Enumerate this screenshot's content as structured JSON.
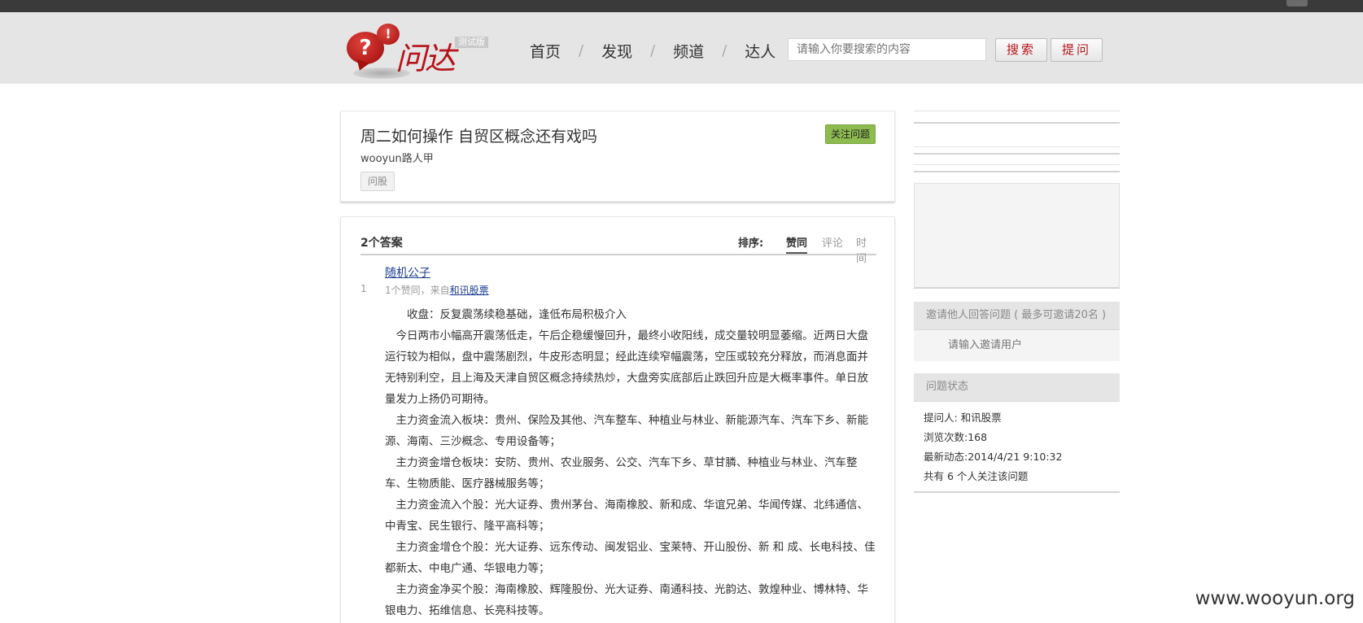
{
  "header": {
    "logo_glyph": "?",
    "logo_small_glyph": "!",
    "logo_text": "问达",
    "beta_badge": "测试版",
    "nav": [
      {
        "label": "首页"
      },
      {
        "label": "发现"
      },
      {
        "label": "频道"
      },
      {
        "label": "达人"
      }
    ],
    "nav_separator": "/",
    "search_placeholder": "请输入你要搜索的内容",
    "search_button": "搜索",
    "ask_button": "提问"
  },
  "question": {
    "title": "周二如何操作 自贸区概念还有戏吗",
    "author": "wooyun路人甲",
    "tag": "问股",
    "follow_button": "关注问题"
  },
  "answers": {
    "count_label": "2个答案",
    "sort_label": "排序:",
    "sort_options": [
      "赞同",
      "评论",
      "时间"
    ],
    "active_sort": "赞同",
    "items": [
      {
        "votes": "1",
        "author": "随机公子",
        "meta_prefix": "1个赞同，来自",
        "source": "和讯股票",
        "paragraphs": [
          "收盘：反复震荡续稳基础，逢低布局积极介入",
          "今日两市小幅高开震荡低走，午后企稳缓慢回升，最终小收阳线，成交量较明显萎缩。近两日大盘运行较为相似，盘中震荡剧烈，牛皮形态明显；经此连续窄幅震荡，空压或较充分释放，而消息面并无特别利空，且上海及天津自贸区概念持续热炒，大盘旁实底部后止跌回升应是大概率事件。单日放量发力上扬仍可期待。",
          "主力资金流入板块：贵州、保险及其他、汽车整车、种植业与林业、新能源汽车、汽车下乡、新能源、海南、三沙概念、专用设备等；",
          "主力资金增仓板块：安防、贵州、农业服务、公交、汽车下乡、草甘膦、种植业与林业、汽车整车、生物质能、医疗器械服务等；",
          "主力资金流入个股：光大证券、贵州茅台、海南橡胶、新和成、华谊兄弟、华闻传媒、北纬通信、中青宝、民生银行、隆平高科等；",
          "主力资金增仓个股：光大证券、远东传动、闽发铝业、宝莱特、开山股份、新 和 成、长电科技、佳都新太、中电广通、华银电力等；",
          "主力资金净买个股：海南橡胶、辉隆股份、光大证券、南通科技、光韵达、敦煌种业、博林特、华银电力、拓维信息、长亮科技等。"
        ]
      }
    ]
  },
  "sidebar": {
    "invite": {
      "title": "邀请他人回答问题 ( 最多可邀请20名 )",
      "placeholder": "请输入邀请用户"
    },
    "status": {
      "title": "问题状态",
      "lines": [
        "提问人: 和讯股票",
        "浏览次数:168",
        "最新动态:2014/4/21 9:10:32",
        "共有 6 个人关注该问题"
      ]
    }
  },
  "watermark": "www.wooyun.org"
}
